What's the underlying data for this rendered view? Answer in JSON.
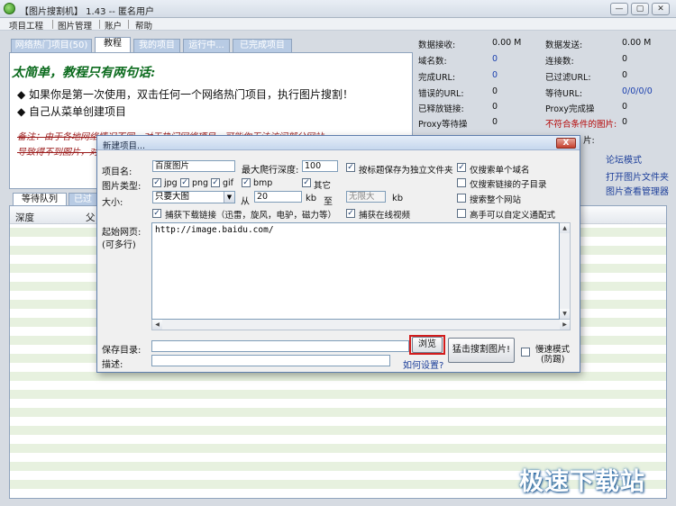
{
  "window": {
    "title": "【图片搜割机】 1.43 -- 匿名用户",
    "minimize": "—",
    "maximize": "▢",
    "close": "✕"
  },
  "menu": [
    "项目工程",
    "图片管理",
    "账户",
    "帮助"
  ],
  "tabs": [
    "网络热门项目(50)",
    "教程",
    "我的项目",
    "运行中...",
    "已完成项目"
  ],
  "tutorial": {
    "title": "太简单，教程只有两句话:",
    "line1": "◆ 如果你是第一次使用，双击任何一个网络热门项目，执行图片搜割！",
    "line2": "◆ 自己从菜单创建项目",
    "note1": "备注：由于各地网络情况不同，对于热门网络项目，可能你无法访问部分网站",
    "note2": "导致得不到图片，对于这样的..."
  },
  "stats": {
    "left": [
      {
        "label": "数据接收:",
        "value": "0.00 M"
      },
      {
        "label": "域名数:",
        "value": "0"
      },
      {
        "label": "完成URL:",
        "value": "0"
      },
      {
        "label": "错误的URL:",
        "value": "0"
      },
      {
        "label": "已释放链接:",
        "value": "0"
      },
      {
        "label": "Proxy等待操",
        "value": "0"
      }
    ],
    "right": [
      {
        "label": "数据发送:",
        "value": "0.00 M"
      },
      {
        "label": "连接数:",
        "value": "0"
      },
      {
        "label": "已过滤URL:",
        "value": "0"
      },
      {
        "label": "等待URL:",
        "value": "0/0/0/0"
      },
      {
        "label": "Proxy完成操",
        "value": "0"
      },
      {
        "label": "不符合条件的图片:",
        "value": "0"
      }
    ],
    "partial": "片:"
  },
  "side_links": [
    "论坛模式",
    "打开图片文件夹",
    "图片查看管理器"
  ],
  "queue": {
    "tab_waiting": "等待队列",
    "tab_done_partial": "已过",
    "col_depth": "深度",
    "col_parent": "父"
  },
  "dialog": {
    "title": "新建项目...",
    "close": "X",
    "project_name_label": "项目名:",
    "project_name_value": "百度图片",
    "max_depth_label": "最大爬行深度:",
    "max_depth_value": "100",
    "image_type_label": "图片类型:",
    "types": [
      "jpg",
      "png",
      "gif",
      "bmp",
      "其它"
    ],
    "size_label": "大小:",
    "size_select": "只要大图",
    "from_label": "从",
    "from_value": "20",
    "kb1": "kb",
    "to_label": "至",
    "to_value": "无限大",
    "kb2": "kb",
    "capture_links": "捕获下载链接（迅雷，旋风，电驴，磁力等）",
    "save_by_title": "按标题保存为独立文件夹",
    "capture_video": "捕获在线视频",
    "only_single_domain": "仅搜索单个域名",
    "only_subdir": "仅搜索链接的子目录",
    "whole_site": "搜索整个网站",
    "custom_wildcard": "高手可以自定义通配式",
    "start_page_label": "起始网页:",
    "start_page_hint": "(可多行)",
    "start_page_value": "http://image.baidu.com/",
    "save_dir_label": "保存目录:",
    "save_dir_value": "",
    "browse": "浏览",
    "desc_label": "描述:",
    "desc_value": "",
    "how_to_set": "如何设置?",
    "start_button": "猛击搜割图片!",
    "slow_mode": "慢速模式",
    "slow_mode_sub": "(防踢)"
  },
  "watermark": "极速下载站"
}
